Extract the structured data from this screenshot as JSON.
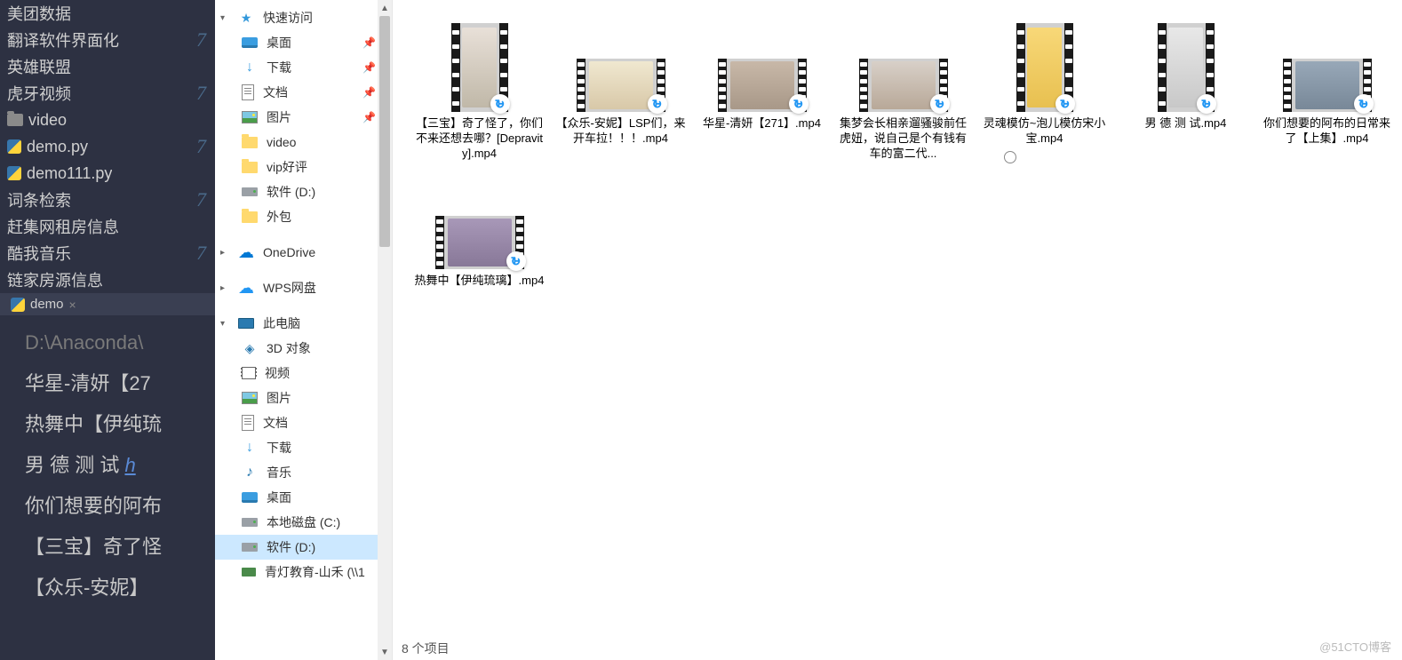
{
  "ide": {
    "tree": [
      {
        "label": "美团数据",
        "count": "",
        "type": "text"
      },
      {
        "label": "翻译软件界面化",
        "count": "7",
        "type": "text"
      },
      {
        "label": "英雄联盟",
        "count": "",
        "type": "text"
      },
      {
        "label": "虎牙视频",
        "count": "7",
        "type": "text"
      },
      {
        "label": "video",
        "count": "",
        "type": "folder"
      },
      {
        "label": "demo.py",
        "count": "7",
        "type": "py"
      },
      {
        "label": "demo111.py",
        "count": "",
        "type": "py"
      },
      {
        "label": "词条检索",
        "count": "7",
        "type": "text"
      },
      {
        "label": "赶集网租房信息",
        "count": "",
        "type": "text"
      },
      {
        "label": "酷我音乐",
        "count": "7",
        "type": "text"
      },
      {
        "label": "链家房源信息",
        "count": "",
        "type": "text"
      }
    ],
    "tab": {
      "icon": "py",
      "name": "demo",
      "close": "×"
    },
    "console_lines": [
      {
        "text": "D:\\Anaconda\\",
        "cls": "dim"
      },
      {
        "text": "华星-清妍【27"
      },
      {
        "text": "热舞中【伊纯琉"
      },
      {
        "text": "男 德 测 试 ",
        "url": "h"
      },
      {
        "text": "你们想要的阿布"
      },
      {
        "text": "【三宝】奇了怪"
      },
      {
        "text": "【众乐-安妮】"
      }
    ]
  },
  "nav": {
    "quick_access": {
      "label": "快速访问"
    },
    "quick_items": [
      {
        "icon": "desktop",
        "label": "桌面",
        "pinned": true
      },
      {
        "icon": "download",
        "label": "下载",
        "pinned": true
      },
      {
        "icon": "doc",
        "label": "文档",
        "pinned": true
      },
      {
        "icon": "pic",
        "label": "图片",
        "pinned": true
      },
      {
        "icon": "folder",
        "label": "video",
        "pinned": false
      },
      {
        "icon": "folder",
        "label": "vip好评",
        "pinned": false
      },
      {
        "icon": "drive",
        "label": "软件 (D:)",
        "pinned": false
      },
      {
        "icon": "folder",
        "label": "外包",
        "pinned": false
      }
    ],
    "onedrive": {
      "label": "OneDrive"
    },
    "wps": {
      "label": "WPS网盘"
    },
    "this_pc": {
      "label": "此电脑"
    },
    "pc_items": [
      {
        "icon": "3d",
        "label": "3D 对象"
      },
      {
        "icon": "video",
        "label": "视频"
      },
      {
        "icon": "pic",
        "label": "图片"
      },
      {
        "icon": "doc",
        "label": "文档"
      },
      {
        "icon": "download",
        "label": "下载"
      },
      {
        "icon": "music",
        "label": "音乐"
      },
      {
        "icon": "desktop",
        "label": "桌面"
      },
      {
        "icon": "drive",
        "label": "本地磁盘 (C:)"
      },
      {
        "icon": "drive",
        "label": "软件 (D:)",
        "selected": true
      },
      {
        "icon": "net",
        "label": "青灯教育-山禾 (\\\\1"
      }
    ]
  },
  "files": [
    {
      "shape": "tall",
      "pal": "p1",
      "name": "【三宝】奇了怪了，你们不来还想去哪？[Depravity].mp4"
    },
    {
      "shape": "wide",
      "pal": "p2",
      "name": "【众乐-安妮】LSP们，来开车拉！！！.mp4"
    },
    {
      "shape": "wide",
      "pal": "p3",
      "name": "华星-清妍【271】.mp4"
    },
    {
      "shape": "wide",
      "pal": "p4",
      "name": "集梦会长相亲遛骚骏前任虎妞，说自己是个有钱有车的富二代..."
    },
    {
      "shape": "tall",
      "pal": "p5",
      "name": "灵魂模仿~泡儿模仿宋小宝.mp4"
    },
    {
      "shape": "tall",
      "pal": "p6",
      "name": "男 德 测 试.mp4"
    },
    {
      "shape": "wide",
      "pal": "p7",
      "name": "你们想要的阿布的日常来了【上集】.mp4"
    },
    {
      "shape": "wide",
      "pal": "p8",
      "name": "热舞中【伊纯琉璃】.mp4"
    }
  ],
  "status": {
    "text": "8 个项目"
  },
  "watermark": "@51CTO博客"
}
